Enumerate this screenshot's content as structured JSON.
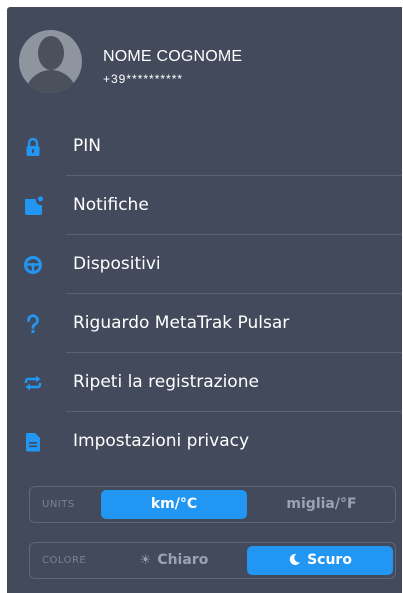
{
  "profile": {
    "name": "NOME COGNOME",
    "phone": "+39**********"
  },
  "menu": {
    "items": [
      {
        "label": "PIN",
        "icon": "lock-icon"
      },
      {
        "label": "Notifiche",
        "icon": "notification-icon"
      },
      {
        "label": "Dispositivi",
        "icon": "steering-wheel-icon"
      },
      {
        "label": "Riguardo MetaTrak Pulsar",
        "icon": "question-icon"
      },
      {
        "label": "Ripeti la registrazione",
        "icon": "repeat-icon"
      },
      {
        "label": "Impostazioni privacy",
        "icon": "document-icon"
      }
    ]
  },
  "units": {
    "tag": "UNITS",
    "option_metric": "km/°C",
    "option_imperial": "miglia/°F",
    "selected": "km/°C"
  },
  "colore": {
    "tag": "COLORE",
    "option_light": "Chiaro",
    "option_dark": "Scuro",
    "selected": "Scuro"
  },
  "colors": {
    "panel": "#434a5c",
    "accent": "#2196f3",
    "separator": "#5a6173"
  }
}
